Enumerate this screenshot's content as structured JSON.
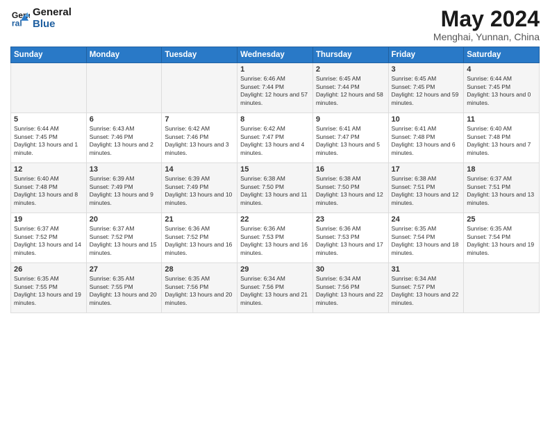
{
  "header": {
    "logo_line1": "General",
    "logo_line2": "Blue",
    "title": "May 2024",
    "subtitle": "Menghai, Yunnan, China"
  },
  "columns": [
    "Sunday",
    "Monday",
    "Tuesday",
    "Wednesday",
    "Thursday",
    "Friday",
    "Saturday"
  ],
  "weeks": [
    [
      {
        "day": "",
        "info": ""
      },
      {
        "day": "",
        "info": ""
      },
      {
        "day": "",
        "info": ""
      },
      {
        "day": "1",
        "info": "Sunrise: 6:46 AM\nSunset: 7:44 PM\nDaylight: 12 hours and 57 minutes."
      },
      {
        "day": "2",
        "info": "Sunrise: 6:45 AM\nSunset: 7:44 PM\nDaylight: 12 hours and 58 minutes."
      },
      {
        "day": "3",
        "info": "Sunrise: 6:45 AM\nSunset: 7:45 PM\nDaylight: 12 hours and 59 minutes."
      },
      {
        "day": "4",
        "info": "Sunrise: 6:44 AM\nSunset: 7:45 PM\nDaylight: 13 hours and 0 minutes."
      }
    ],
    [
      {
        "day": "5",
        "info": "Sunrise: 6:44 AM\nSunset: 7:45 PM\nDaylight: 13 hours and 1 minute."
      },
      {
        "day": "6",
        "info": "Sunrise: 6:43 AM\nSunset: 7:46 PM\nDaylight: 13 hours and 2 minutes."
      },
      {
        "day": "7",
        "info": "Sunrise: 6:42 AM\nSunset: 7:46 PM\nDaylight: 13 hours and 3 minutes."
      },
      {
        "day": "8",
        "info": "Sunrise: 6:42 AM\nSunset: 7:47 PM\nDaylight: 13 hours and 4 minutes."
      },
      {
        "day": "9",
        "info": "Sunrise: 6:41 AM\nSunset: 7:47 PM\nDaylight: 13 hours and 5 minutes."
      },
      {
        "day": "10",
        "info": "Sunrise: 6:41 AM\nSunset: 7:48 PM\nDaylight: 13 hours and 6 minutes."
      },
      {
        "day": "11",
        "info": "Sunrise: 6:40 AM\nSunset: 7:48 PM\nDaylight: 13 hours and 7 minutes."
      }
    ],
    [
      {
        "day": "12",
        "info": "Sunrise: 6:40 AM\nSunset: 7:48 PM\nDaylight: 13 hours and 8 minutes."
      },
      {
        "day": "13",
        "info": "Sunrise: 6:39 AM\nSunset: 7:49 PM\nDaylight: 13 hours and 9 minutes."
      },
      {
        "day": "14",
        "info": "Sunrise: 6:39 AM\nSunset: 7:49 PM\nDaylight: 13 hours and 10 minutes."
      },
      {
        "day": "15",
        "info": "Sunrise: 6:38 AM\nSunset: 7:50 PM\nDaylight: 13 hours and 11 minutes."
      },
      {
        "day": "16",
        "info": "Sunrise: 6:38 AM\nSunset: 7:50 PM\nDaylight: 13 hours and 12 minutes."
      },
      {
        "day": "17",
        "info": "Sunrise: 6:38 AM\nSunset: 7:51 PM\nDaylight: 13 hours and 12 minutes."
      },
      {
        "day": "18",
        "info": "Sunrise: 6:37 AM\nSunset: 7:51 PM\nDaylight: 13 hours and 13 minutes."
      }
    ],
    [
      {
        "day": "19",
        "info": "Sunrise: 6:37 AM\nSunset: 7:52 PM\nDaylight: 13 hours and 14 minutes."
      },
      {
        "day": "20",
        "info": "Sunrise: 6:37 AM\nSunset: 7:52 PM\nDaylight: 13 hours and 15 minutes."
      },
      {
        "day": "21",
        "info": "Sunrise: 6:36 AM\nSunset: 7:52 PM\nDaylight: 13 hours and 16 minutes."
      },
      {
        "day": "22",
        "info": "Sunrise: 6:36 AM\nSunset: 7:53 PM\nDaylight: 13 hours and 16 minutes."
      },
      {
        "day": "23",
        "info": "Sunrise: 6:36 AM\nSunset: 7:53 PM\nDaylight: 13 hours and 17 minutes."
      },
      {
        "day": "24",
        "info": "Sunrise: 6:35 AM\nSunset: 7:54 PM\nDaylight: 13 hours and 18 minutes."
      },
      {
        "day": "25",
        "info": "Sunrise: 6:35 AM\nSunset: 7:54 PM\nDaylight: 13 hours and 19 minutes."
      }
    ],
    [
      {
        "day": "26",
        "info": "Sunrise: 6:35 AM\nSunset: 7:55 PM\nDaylight: 13 hours and 19 minutes."
      },
      {
        "day": "27",
        "info": "Sunrise: 6:35 AM\nSunset: 7:55 PM\nDaylight: 13 hours and 20 minutes."
      },
      {
        "day": "28",
        "info": "Sunrise: 6:35 AM\nSunset: 7:56 PM\nDaylight: 13 hours and 20 minutes."
      },
      {
        "day": "29",
        "info": "Sunrise: 6:34 AM\nSunset: 7:56 PM\nDaylight: 13 hours and 21 minutes."
      },
      {
        "day": "30",
        "info": "Sunrise: 6:34 AM\nSunset: 7:56 PM\nDaylight: 13 hours and 22 minutes."
      },
      {
        "day": "31",
        "info": "Sunrise: 6:34 AM\nSunset: 7:57 PM\nDaylight: 13 hours and 22 minutes."
      },
      {
        "day": "",
        "info": ""
      }
    ]
  ]
}
